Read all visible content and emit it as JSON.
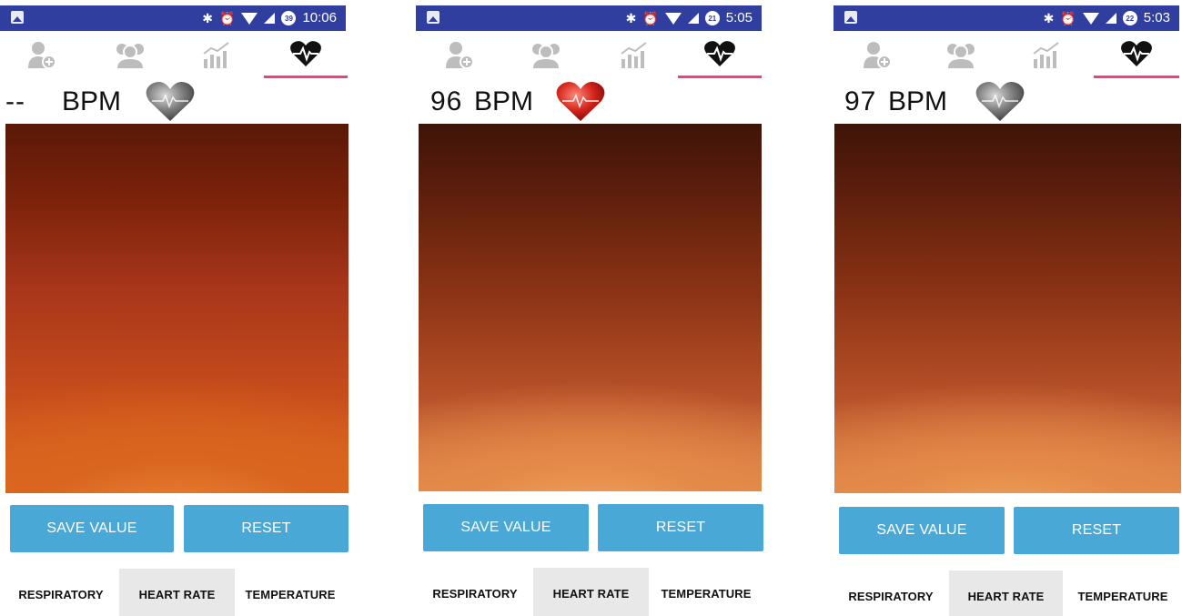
{
  "colors": {
    "statusbar": "#303f9f",
    "tab_indicator": "#e8437a",
    "button": "#4aa8d6",
    "active_nav_bg": "#e8e8e8"
  },
  "tabs": [
    {
      "icon": "add-user-icon"
    },
    {
      "icon": "group-icon"
    },
    {
      "icon": "bar-chart-icon"
    },
    {
      "icon": "heart-pulse-icon",
      "selected": true
    }
  ],
  "screens": [
    {
      "statusbar": {
        "time": "10:06",
        "notif_badge": "39"
      },
      "heart_rate": {
        "value": "--",
        "unit": "BPM",
        "heart_icon": "heart-gray-icon"
      },
      "buttons": {
        "save": "SAVE VALUE",
        "reset": "RESET"
      },
      "bottom_nav": [
        "RESPIRATORY",
        "HEART RATE",
        "TEMPERATURE"
      ],
      "bottom_nav_selected": "HEART RATE"
    },
    {
      "statusbar": {
        "time": "5:05",
        "notif_badge": "21"
      },
      "heart_rate": {
        "value": "96",
        "unit": "BPM",
        "heart_icon": "heart-red-icon"
      },
      "buttons": {
        "save": "SAVE VALUE",
        "reset": "RESET"
      },
      "bottom_nav": [
        "RESPIRATORY",
        "HEART RATE",
        "TEMPERATURE"
      ],
      "bottom_nav_selected": "HEART RATE"
    },
    {
      "statusbar": {
        "time": "5:03",
        "notif_badge": "22"
      },
      "heart_rate": {
        "value": "97",
        "unit": "BPM",
        "heart_icon": "heart-gray-icon"
      },
      "buttons": {
        "save": "SAVE VALUE",
        "reset": "RESET"
      },
      "bottom_nav": [
        "RESPIRATORY",
        "HEART RATE",
        "TEMPERATURE"
      ],
      "bottom_nav_selected": "HEART RATE"
    }
  ]
}
